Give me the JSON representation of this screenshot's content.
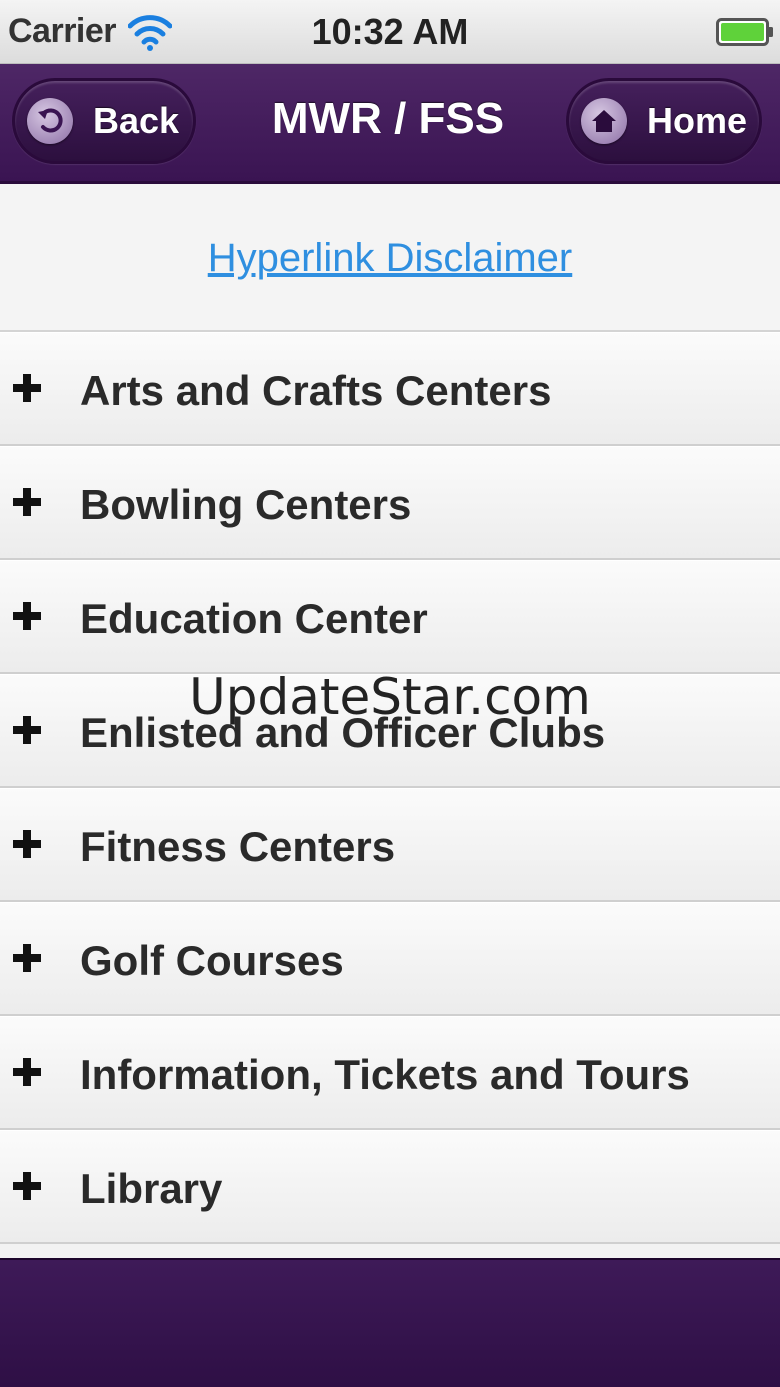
{
  "status_bar": {
    "carrier": "Carrier",
    "time": "10:32 AM",
    "icons": [
      "wifi-icon",
      "battery-icon"
    ]
  },
  "nav_bar": {
    "title": "MWR / FSS",
    "back_label": "Back",
    "home_label": "Home",
    "icons": [
      "back-arrow-icon",
      "home-icon"
    ]
  },
  "content": {
    "disclaimer_link": "Hyperlink Disclaimer",
    "menu_items": [
      {
        "icon": "plus-icon",
        "label": "Arts and Crafts Centers"
      },
      {
        "icon": "plus-icon",
        "label": "Bowling Centers"
      },
      {
        "icon": "plus-icon",
        "label": "Education Center"
      },
      {
        "icon": "plus-icon",
        "label": "Enlisted and Officer Clubs"
      },
      {
        "icon": "plus-icon",
        "label": "Fitness Centers"
      },
      {
        "icon": "plus-icon",
        "label": "Golf Courses"
      },
      {
        "icon": "plus-icon",
        "label": "Information, Tickets and Tours"
      },
      {
        "icon": "plus-icon",
        "label": "Library"
      }
    ]
  },
  "watermark": "UpdateStar.com",
  "colors": {
    "nav_purple": "#3a1452",
    "link_blue": "#2f8fe0",
    "battery_green": "#5fd23a"
  }
}
